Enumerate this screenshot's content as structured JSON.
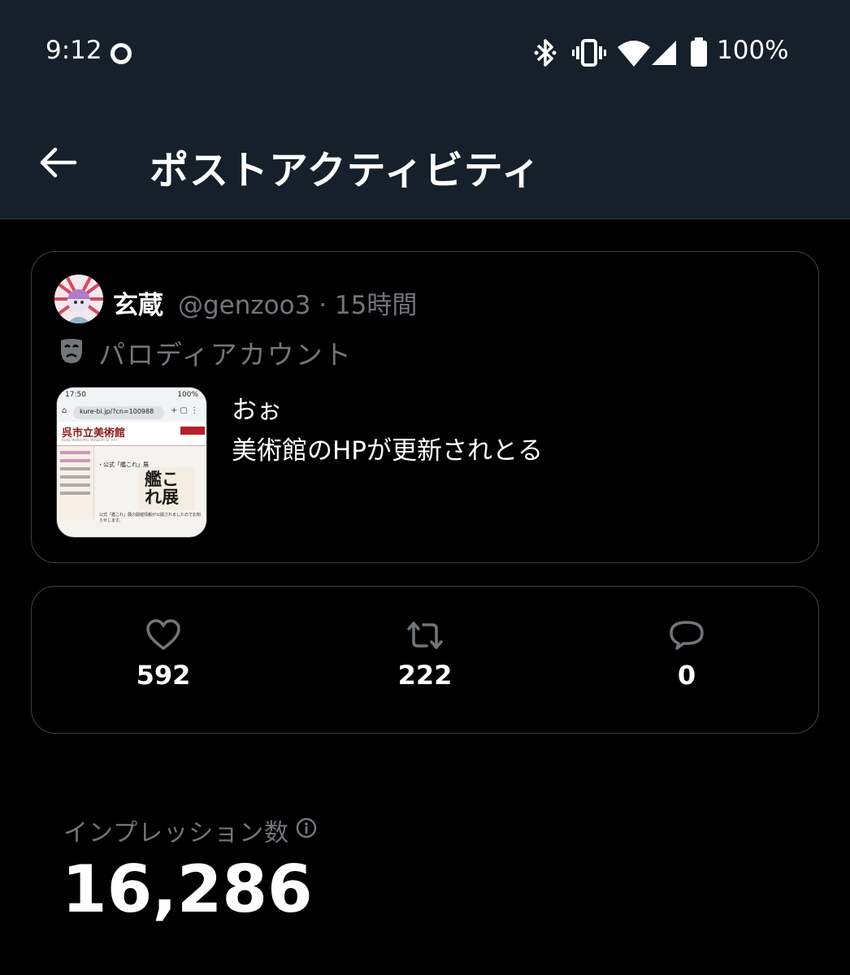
{
  "status_bar": {
    "time": "9:12",
    "battery": "100%",
    "icons": [
      "record-icon",
      "bluetooth-icon",
      "vibrate-icon",
      "wifi-icon",
      "signal-icon",
      "battery-icon"
    ]
  },
  "header": {
    "title": "ポストアクティビティ",
    "back_icon": "arrow-left-icon"
  },
  "post": {
    "author_name": "玄蔵",
    "handle": "@genzoo3",
    "separator": "·",
    "time": "15時間",
    "parody_label": "パロディアカウント",
    "text_line1": "おぉ",
    "text_line2": "美術館のHPが更新されとる",
    "thumbnail": {
      "status_time": "17:50",
      "status_battery": "100%",
      "url": "kure-bi.jp/?cn=100988",
      "site_title": "呉市立美術館",
      "site_subtitle": "KURE MUNICIPAL MUSEUM OF ART",
      "section_title": "・公式「艦これ」展",
      "poster_text": "艦これ展",
      "body_text": "公式「艦これ」展の開催情報が公開されましたのでお知らせします。"
    }
  },
  "stats": {
    "likes": "592",
    "reposts": "222",
    "replies": "0"
  },
  "impressions": {
    "label": "インプレッション数",
    "value": "16,286"
  },
  "colors": {
    "background": "#000000",
    "header_bg": "#15202b",
    "muted_text": "#71767b",
    "border": "#3e4144"
  }
}
